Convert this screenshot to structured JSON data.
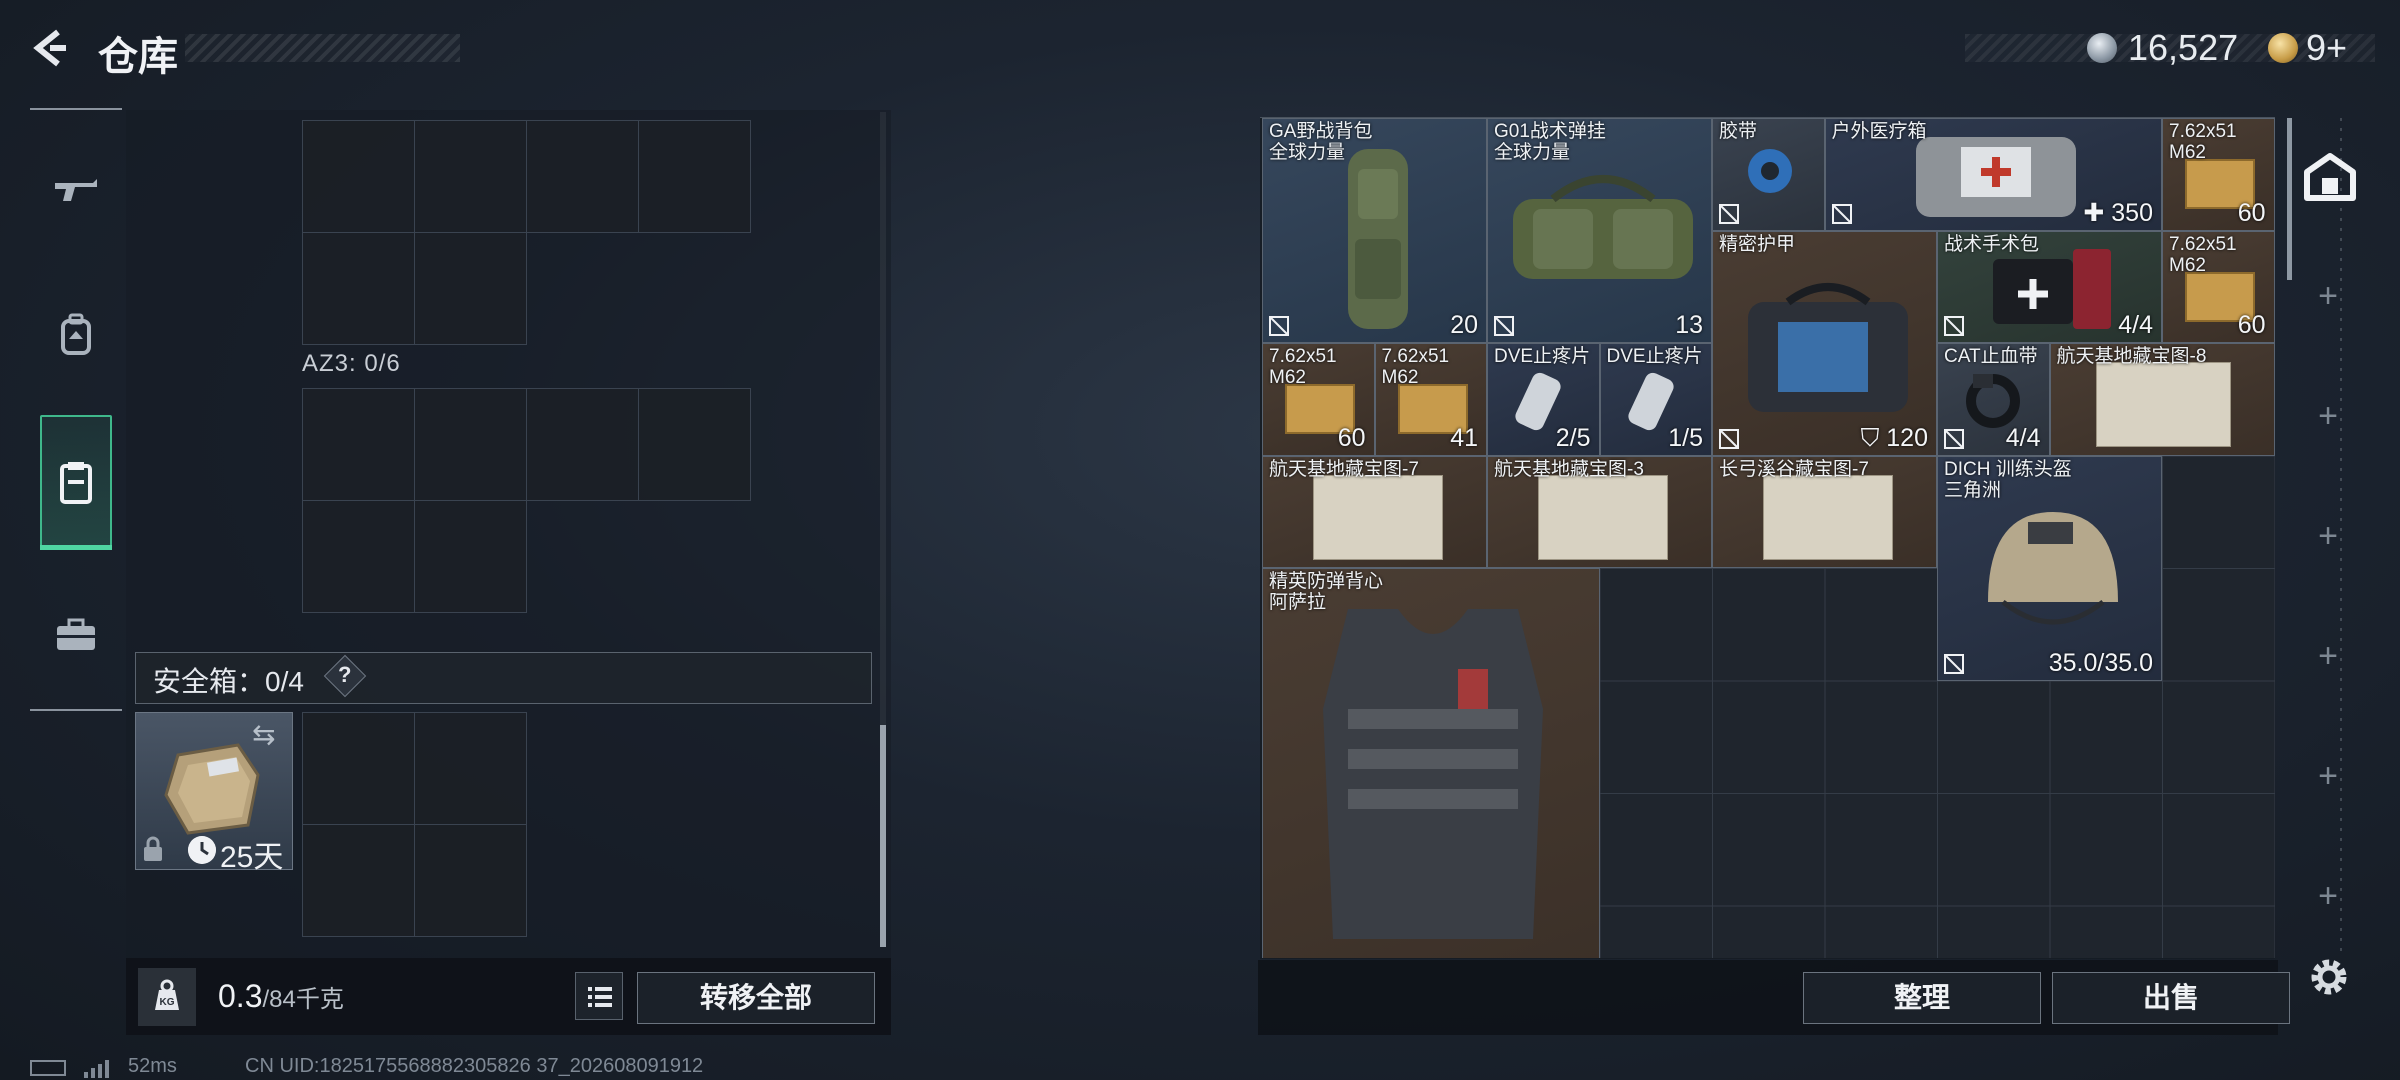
{
  "header": {
    "title": "仓库",
    "money": "16,527",
    "tokens": "9+"
  },
  "nav": {
    "items": [
      {
        "icon": "rifle-icon"
      },
      {
        "icon": "backpack-icon"
      },
      {
        "icon": "vest-icon",
        "active": true
      },
      {
        "icon": "briefcase-icon"
      }
    ]
  },
  "left": {
    "az3_label": "AZ3: 0/6",
    "secure_label": "安全箱：0/4",
    "help": "?",
    "case_days": "25天",
    "weight_value": "0.3",
    "weight_max": "/84千克",
    "transfer_all": "转移全部"
  },
  "stash": {
    "items": [
      {
        "name": "GA野战背包\n全球力量",
        "value": "20",
        "bg": "blue"
      },
      {
        "name": "G01战术弹挂\n全球力量",
        "value": "13",
        "bg": "blue"
      },
      {
        "name": "胶带",
        "value": "",
        "bg": "gray"
      },
      {
        "name": "户外医疗箱",
        "value": "350",
        "bg": "navy"
      },
      {
        "name": "7.62x51\nM62",
        "value": "60",
        "bg": "brown"
      },
      {
        "name": "精密护甲",
        "value": "120",
        "bg": "brown"
      },
      {
        "name": "战术手术包",
        "value": "4/4",
        "bg": "green"
      },
      {
        "name": "7.62x51\nM62",
        "value": "60",
        "bg": "brown"
      },
      {
        "name": "7.62x51\nM62",
        "value": "60",
        "bg": "brown"
      },
      {
        "name": "7.62x51\nM62",
        "value": "41",
        "bg": "brown"
      },
      {
        "name": "DVE止疼片",
        "value": "2/5",
        "bg": "navy"
      },
      {
        "name": "DVE止疼片",
        "value": "1/5",
        "bg": "navy"
      },
      {
        "name": "CAT止血带",
        "value": "4/4",
        "bg": "gray"
      },
      {
        "name": "航天基地藏宝图-8",
        "value": "",
        "bg": "brown"
      },
      {
        "name": "航天基地藏宝图-7",
        "value": "",
        "bg": "brown"
      },
      {
        "name": "航天基地藏宝图-3",
        "value": "",
        "bg": "brown"
      },
      {
        "name": "长弓溪谷藏宝图-7",
        "value": "",
        "bg": "brown"
      },
      {
        "name": "DICH 训练头盔\n三角洲",
        "value": "35.0/35.0",
        "bg": "navy"
      },
      {
        "name": "精英防弹背心\n阿萨拉",
        "value": "",
        "bg": "brown"
      }
    ],
    "organize": "整理",
    "sell": "出售"
  },
  "footer": {
    "ping": "52ms",
    "uid": "CN UID:1825175568882305826 37_202608091912"
  }
}
